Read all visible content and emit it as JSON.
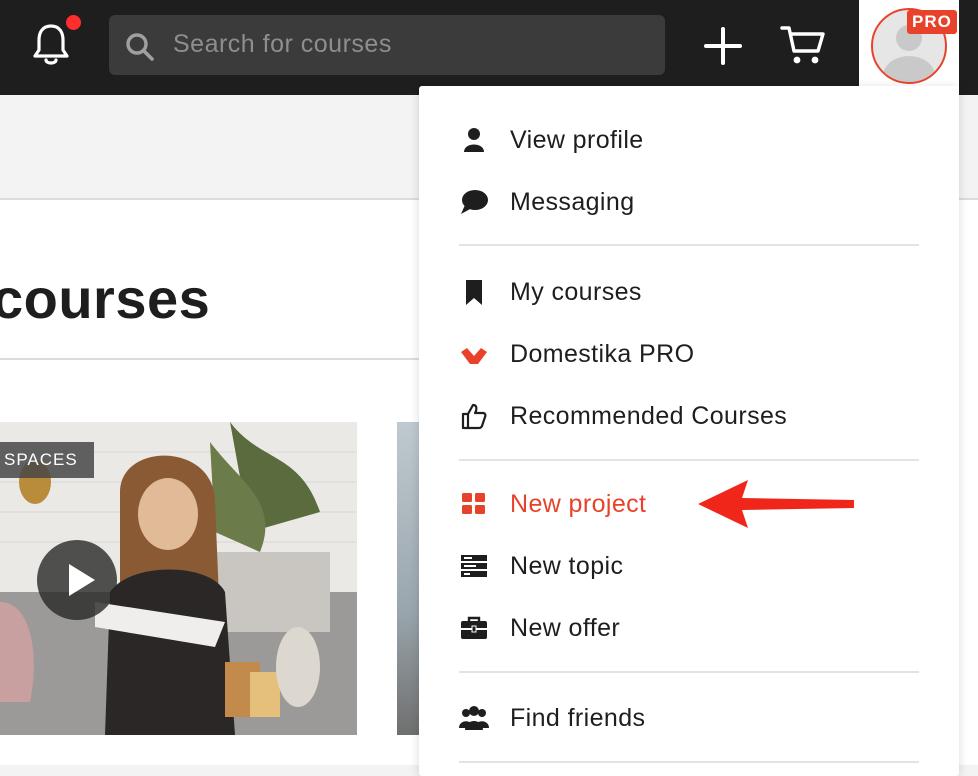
{
  "topbar": {
    "search_placeholder": "Search for courses",
    "notification_dot_color": "#ff2d2d",
    "pro_badge": "PRO",
    "icons": [
      "bell-icon",
      "search-icon",
      "plus-icon",
      "cart-icon",
      "avatar"
    ]
  },
  "page": {
    "heading": "courses",
    "card1_tag": "SPACES"
  },
  "menu": {
    "items": [
      {
        "label": "View profile",
        "icon": "user-icon"
      },
      {
        "label": "Messaging",
        "icon": "chat-bubble-icon"
      },
      {
        "label": "My courses",
        "icon": "bookmark-icon"
      },
      {
        "label": "Domestika PRO",
        "icon": "domestika-logo-icon"
      },
      {
        "label": "Recommended Courses",
        "icon": "thumbs-up-icon"
      },
      {
        "label": "New project",
        "icon": "grid-icon"
      },
      {
        "label": "New topic",
        "icon": "topic-list-icon"
      },
      {
        "label": "New offer",
        "icon": "briefcase-icon"
      },
      {
        "label": "Find friends",
        "icon": "people-icon"
      }
    ]
  },
  "colors": {
    "accent": "#e8432a",
    "topbar_bg": "#1e1e1e",
    "annotation_arrow": "#f0261b"
  }
}
